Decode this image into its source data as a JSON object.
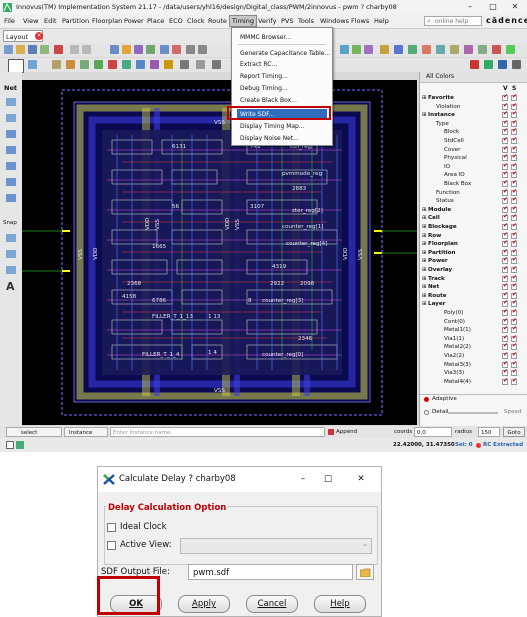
{
  "window": {
    "title": "Innovus(TM) Implementation System 21.17 - /data/users/yhl16/design/Digital_class/PWM/2innovus - pwm ? charby08",
    "controls": [
      "–",
      "□",
      "✕"
    ]
  },
  "menubar": {
    "items": [
      "File",
      "View",
      "Edit",
      "Partition",
      "Floorplan",
      "Power",
      "Place",
      "ECO",
      "Clock",
      "Route",
      "Timing",
      "Verify",
      "PVS",
      "Tools",
      "Windows",
      "Flows",
      "Help"
    ],
    "active": "Timing",
    "search_placeholder": "online help",
    "brand": "cādence"
  },
  "tabs": {
    "layout": "Layout"
  },
  "timing_menu": {
    "items": [
      "MMMC Browser...",
      "Generate Capacitance Table...",
      "Extract RC...",
      "Report Timing...",
      "Debug Timing...",
      "Create Black Box...",
      "Write SDF...",
      "Display Timing Map...",
      "Display Noise Net..."
    ],
    "highlighted": "Write SDF...",
    "highlight_color": "#2f6dbc",
    "annotation_color": "#c00000"
  },
  "left_tools": {
    "net_label": "Net",
    "snap_label": "Snap",
    "text_tool": "A"
  },
  "canvas": {
    "labels": [
      "VSS",
      "VDD",
      "VSS",
      "VDD",
      "VSS",
      "VSS",
      "VDD",
      "VSS",
      "VDD",
      "VSS",
      "6131",
      "741",
      "2883",
      "56",
      "3107",
      "1665",
      "4319",
      "2368",
      "2922",
      "2098",
      "4158",
      "6786",
      "8",
      "1 13",
      "2346",
      "1 4",
      "pvmmode_reg",
      "ctrl_reg[",
      "counter_reg[4]",
      "zter_reg[2]",
      "counter_reg[1]",
      "counter_reg[3]",
      "FILLER_T_1_13",
      "FILLER_T_1_4",
      "counter_reg[0]"
    ]
  },
  "right_panel": {
    "header": "All Colors",
    "column_v": "V",
    "column_s": "S",
    "tree": [
      {
        "label": "Favorite",
        "bold": true,
        "indent": 0
      },
      {
        "label": "Violation",
        "bold": false,
        "indent": 1
      },
      {
        "label": "Instance",
        "bold": true,
        "indent": 0
      },
      {
        "label": "Type",
        "bold": false,
        "indent": 1
      },
      {
        "label": "Block",
        "bold": false,
        "indent": 2
      },
      {
        "label": "StdCell",
        "bold": false,
        "indent": 2
      },
      {
        "label": "Cover",
        "bold": false,
        "indent": 2
      },
      {
        "label": "Physical",
        "bold": false,
        "indent": 2
      },
      {
        "label": "IO",
        "bold": false,
        "indent": 2
      },
      {
        "label": "Area IO",
        "bold": false,
        "indent": 2
      },
      {
        "label": "Black Box",
        "bold": false,
        "indent": 2
      },
      {
        "label": "Function",
        "bold": false,
        "indent": 1
      },
      {
        "label": "Status",
        "bold": false,
        "indent": 1
      },
      {
        "label": "Module",
        "bold": true,
        "indent": 0
      },
      {
        "label": "Cell",
        "bold": true,
        "indent": 0
      },
      {
        "label": "Blockage",
        "bold": true,
        "indent": 0
      },
      {
        "label": "Row",
        "bold": true,
        "indent": 0
      },
      {
        "label": "Floorplan",
        "bold": true,
        "indent": 0
      },
      {
        "label": "Partition",
        "bold": true,
        "indent": 0
      },
      {
        "label": "Power",
        "bold": true,
        "indent": 0
      },
      {
        "label": "Overlay",
        "bold": true,
        "indent": 0
      },
      {
        "label": "Track",
        "bold": true,
        "indent": 0
      },
      {
        "label": "Net",
        "bold": true,
        "indent": 0
      },
      {
        "label": "Route",
        "bold": true,
        "indent": 0
      },
      {
        "label": "Layer",
        "bold": true,
        "indent": 0
      },
      {
        "label": "Poly(0)",
        "bold": false,
        "indent": 2
      },
      {
        "label": "Cont(0)",
        "bold": false,
        "indent": 2
      },
      {
        "label": "Metal1(1)",
        "bold": false,
        "indent": 2
      },
      {
        "label": "Via1(1)",
        "bold": false,
        "indent": 2
      },
      {
        "label": "Metal2(2)",
        "bold": false,
        "indent": 2
      },
      {
        "label": "Via2(2)",
        "bold": false,
        "indent": 2
      },
      {
        "label": "Metal3(3)",
        "bold": false,
        "indent": 2
      },
      {
        "label": "Via3(3)",
        "bold": false,
        "indent": 2
      },
      {
        "label": "Metal4(4)",
        "bold": false,
        "indent": 2
      }
    ],
    "adaptive": "Adaptive",
    "detail": "Detail",
    "speed": "Speed"
  },
  "statusbar": {
    "select": "select",
    "instance": "Instance",
    "placeholder": "Enter Instance name.",
    "append": "Append",
    "coords_label": "coords",
    "coords_value": "0,0",
    "radius_label": "radius",
    "radius_value": "150",
    "goto": "Goto",
    "cursor": "22.42000, 31.47350",
    "selection": "Sel: 0",
    "rc": "RC Extracted"
  },
  "dialog": {
    "title": "Calculate Delay ? charby08",
    "section": "Delay Calculation Option",
    "ideal_clock": "Ideal Clock",
    "active_view": "Active View:",
    "sdf_label": "SDF Output File:",
    "sdf_value": "pwm.sdf",
    "ok": "OK",
    "apply": "Apply",
    "cancel": "Cancel",
    "help": "Help"
  }
}
